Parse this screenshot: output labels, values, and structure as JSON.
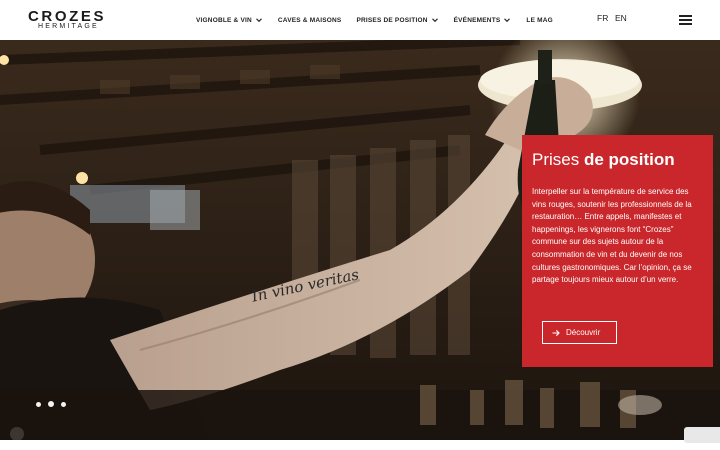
{
  "brand": {
    "name": "CROZES",
    "sub": "HERMITAGE"
  },
  "nav": {
    "items": [
      {
        "label": "VIGNOBLE & VIN",
        "dropdown": true
      },
      {
        "label": "CAVES & MAISONS",
        "dropdown": false
      },
      {
        "label": "PRISES DE POSITION",
        "dropdown": true
      },
      {
        "label": "ÉVÉNEMENTS",
        "dropdown": true
      },
      {
        "label": "LE MAG",
        "dropdown": false
      }
    ]
  },
  "lang": {
    "fr": "FR",
    "en": "EN"
  },
  "hero": {
    "card": {
      "title_light": "Prises ",
      "title_bold": "de position",
      "text": "Interpeller sur la température de service des vins rouges, soutenir les professionnels de la restauration… Entre appels, manifestes et happenings, les vignerons font “Crozes” commune sur des sujets autour de la consommation de vin et du devenir de nos cultures gastronomiques. Car l’opinion, ça se partage toujours mieux autour d’un verre.",
      "button": "Découvrir"
    },
    "tattoo_text": "In vino veritas",
    "slides_total": 3,
    "slide_active": 2
  },
  "colors": {
    "accent": "#c9272b",
    "header_bg": "#ffffff",
    "text": "#222222"
  }
}
